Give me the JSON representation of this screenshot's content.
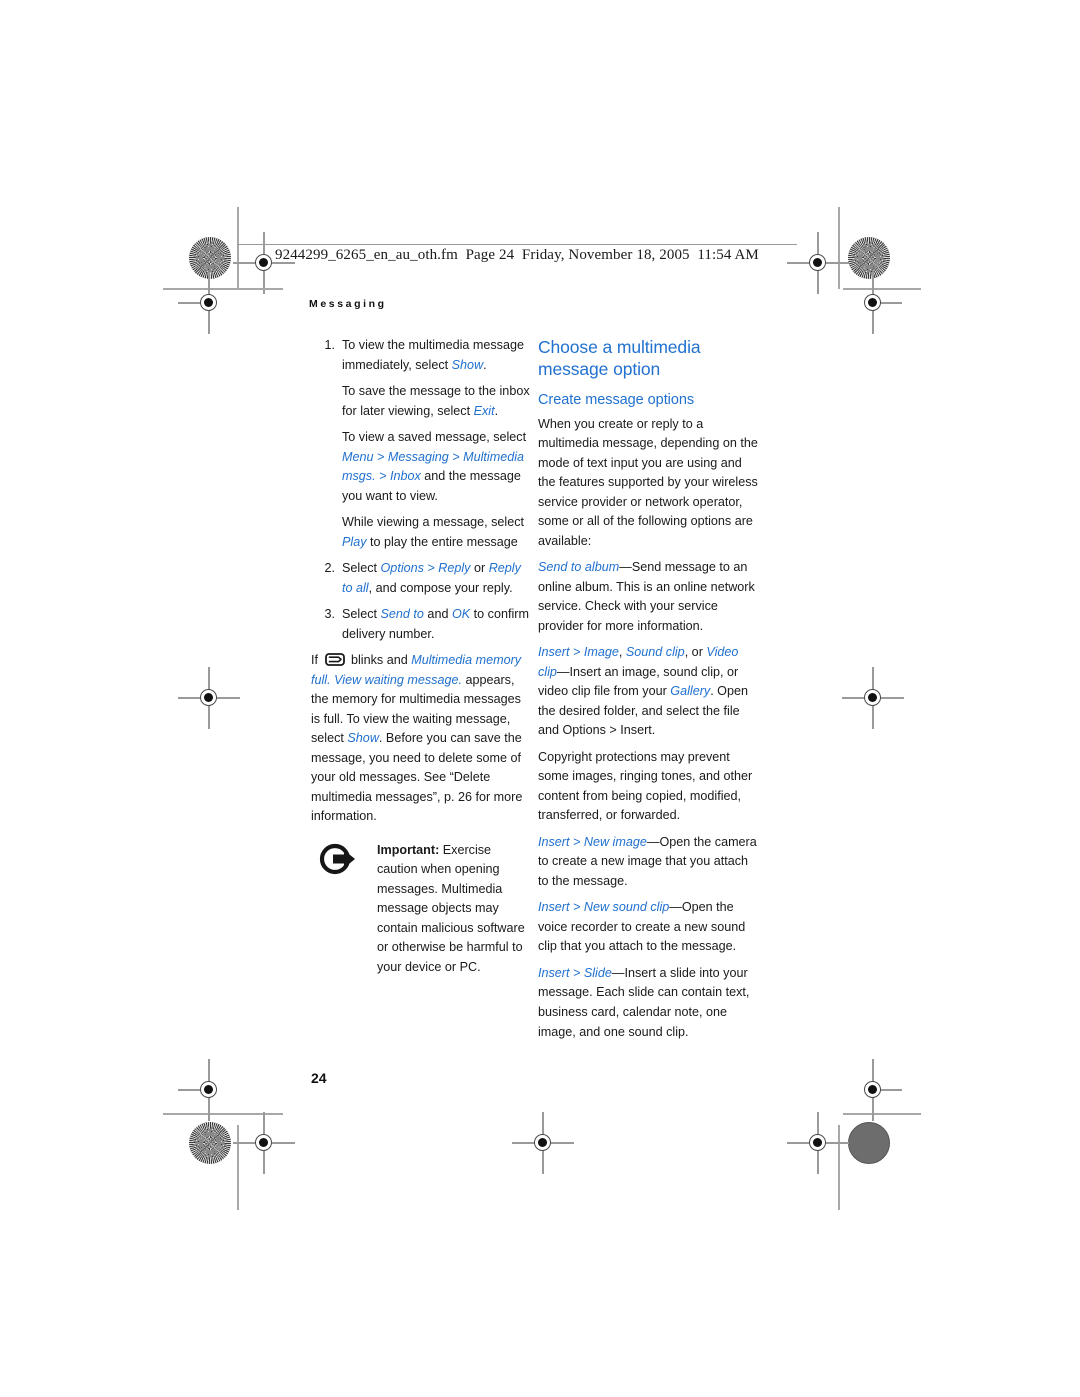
{
  "document": {
    "header_slug": "9244299_6265_en_au_oth.fm  Page 24  Friday, November 18, 2005  11:54 AM",
    "chapter_running_head": "Messaging",
    "page_number": "24",
    "accent_color": "#2171cf",
    "body_color": "#1a1a1a"
  },
  "left_column": {
    "step1": {
      "marker": "1.",
      "line_a_pre": "To view the multimedia message immediately, select ",
      "line_a_em": "Show",
      "line_a_post": "."
    },
    "para_save": {
      "pre": "To save the message to the inbox for later viewing, select ",
      "em": "Exit",
      "post": "."
    },
    "para_saved_msg": {
      "pre": "To view a saved message, select ",
      "em1": "Menu",
      "sep1": " > ",
      "em2": "Messaging",
      "sep2": " > ",
      "em3": "Multimedia msgs.",
      "sep3": " > ",
      "em4": "Inbox",
      "post": " and the message you want to view."
    },
    "para_play": {
      "pre": "While viewing a message, select ",
      "em": "Play",
      "post": " to play the entire message"
    },
    "step2": {
      "marker": "2.",
      "pre": "Select ",
      "em1": "Options",
      "sep1": " > ",
      "em2": "Reply",
      "sep2": " or ",
      "em3": "Reply to all",
      "post": ", and compose your reply."
    },
    "step3": {
      "marker": "3.",
      "pre": "Select ",
      "em1": "Send to",
      "sep1": " and ",
      "em2": "OK",
      "post": " to confirm delivery number."
    },
    "para_memory_full": {
      "pre": "If ",
      "icon": "envelope-icon",
      "mid": " blinks and ",
      "em": "Multimedia memory full. View waiting message.",
      "post1": " appears, the memory for multimedia messages is full. To view the waiting message, select ",
      "em2": "Show",
      "post2": ". Before you can save the message, you need to delete some of your old messages. See “Delete multimedia messages”, p. 26 for more information."
    },
    "note": {
      "icon": "arrow-circle-icon",
      "label": "Important:",
      "text": " Exercise caution when opening messages. Multimedia message objects may contain malicious software or otherwise be harmful to your device or PC."
    }
  },
  "right_column": {
    "title": "Choose a multimedia message option",
    "subtitle": "Create message options",
    "intro": "When you create or reply to a multimedia message, depending on the mode of text input you are using and the features supported by your wireless service provider or network operator, some or all of the following options are available:",
    "opt_send_album": {
      "em": "Send to album",
      "post": "—Send message to an online album. This is an online network service. Check with your service provider for more information."
    },
    "opt_insert_media": {
      "em1": "Insert",
      "sep1": " > ",
      "em2": "Image",
      "sep2": ", ",
      "em3": "Sound clip",
      "sep3": ", or ",
      "em4": "Video clip",
      "post1": "—Insert an image, sound clip, or video clip file from your ",
      "em5": "Gallery",
      "post2": ". Open the desired folder, and select the file and Options > Insert."
    },
    "para_copyright": "Copyright protections may prevent some images, ringing tones, and other content from being copied, modified, transferred, or forwarded.",
    "opt_new_image": {
      "em1": "Insert",
      "sep1": " > ",
      "em2": "New image",
      "post": "—Open the camera to create a new image that you attach to the message."
    },
    "opt_new_sound": {
      "em1": "Insert",
      "sep1": " > ",
      "em2": "New sound clip",
      "post": "—Open the voice recorder to create a new sound clip that you attach to the message."
    },
    "opt_slide": {
      "em1": "Insert",
      "sep1": " > ",
      "em2": "Slide",
      "post": "—Insert a slide into your message. Each slide can contain text, business card, calendar note, one image, and one sound clip."
    }
  }
}
